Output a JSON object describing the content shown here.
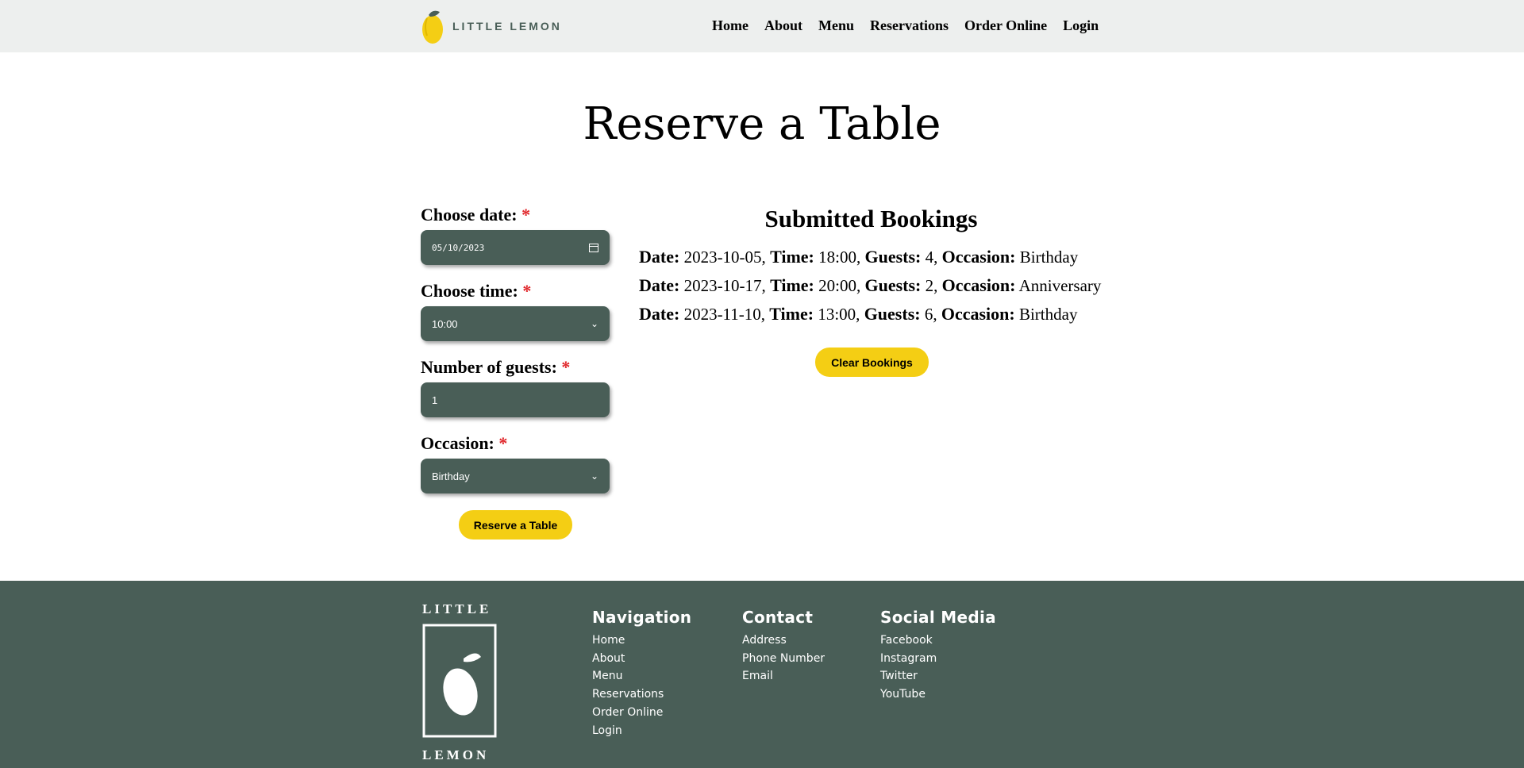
{
  "header": {
    "logo_text": "LITTLE LEMON",
    "nav": [
      "Home",
      "About",
      "Menu",
      "Reservations",
      "Order Online",
      "Login"
    ]
  },
  "main": {
    "title": "Reserve a Table",
    "form": {
      "date_label": "Choose date:",
      "date_value": "05/10/2023",
      "time_label": "Choose time:",
      "time_value": "10:00",
      "guests_label": "Number of guests:",
      "guests_value": "1",
      "occasion_label": "Occasion:",
      "occasion_value": "Birthday",
      "required_mark": "*",
      "submit_label": "Reserve a Table"
    },
    "bookings": {
      "title": "Submitted Bookings",
      "labels": {
        "date": "Date:",
        "time": "Time:",
        "guests": "Guests:",
        "occasion": "Occasion:"
      },
      "items": [
        {
          "date": "2023-10-05,",
          "time": "18:00,",
          "guests": "4,",
          "occasion": "Birthday"
        },
        {
          "date": "2023-10-17,",
          "time": "20:00,",
          "guests": "2,",
          "occasion": "Anniversary"
        },
        {
          "date": "2023-11-10,",
          "time": "13:00,",
          "guests": "6,",
          "occasion": "Birthday"
        }
      ],
      "clear_label": "Clear Bookings"
    }
  },
  "footer": {
    "logo_top": "LITTLE",
    "logo_bottom": "LEMON",
    "navigation": {
      "title": "Navigation",
      "items": [
        "Home",
        "About",
        "Menu",
        "Reservations",
        "Order Online",
        "Login"
      ]
    },
    "contact": {
      "title": "Contact",
      "items": [
        "Address",
        "Phone Number",
        "Email"
      ]
    },
    "social": {
      "title": "Social Media",
      "items": [
        "Facebook",
        "Instagram",
        "Twitter",
        "YouTube"
      ]
    }
  },
  "colors": {
    "primary_green": "#495e57",
    "accent_yellow": "#f4ce14",
    "header_bg": "#edefee",
    "required_red": "#e0262a"
  }
}
